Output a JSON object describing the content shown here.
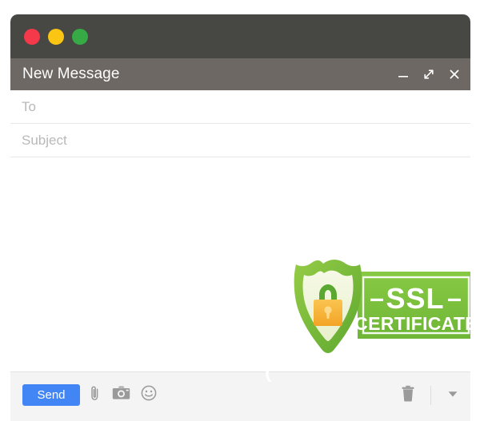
{
  "window": {
    "title": "New Message",
    "traffic_lights": [
      {
        "name": "close-traffic-light",
        "color": "#f5394a"
      },
      {
        "name": "minimize-traffic-light",
        "color": "#fbc513"
      },
      {
        "name": "maximize-traffic-light",
        "color": "#36ab45"
      }
    ],
    "controls": [
      {
        "name": "minimize-window-button",
        "icon": "minimize-icon"
      },
      {
        "name": "expand-window-button",
        "icon": "expand-diagonal-icon"
      },
      {
        "name": "close-window-button",
        "icon": "close-icon"
      }
    ],
    "chrome_bar_color": "#474744",
    "title_bar_color": "#6d6863"
  },
  "fields": [
    {
      "name": "to-field",
      "placeholder": "To",
      "value": ""
    },
    {
      "name": "subject-field",
      "placeholder": "Subject",
      "value": ""
    }
  ],
  "body": {
    "placeholder": "",
    "value": ""
  },
  "badge": {
    "line1": "SSL",
    "dash_left": "–",
    "dash_right": "–",
    "line2": "CERTIFICATE",
    "icon": "shield-lock-icon",
    "colors": {
      "shield_outer": "#6cb33f",
      "shield_mid": "#8cc63e",
      "shield_inner": "#f0f5d8",
      "box_green": "#79c143",
      "lock_body": "#f7b731",
      "lock_shackle": "#5aa832",
      "text": "#ffffff"
    }
  },
  "toolbar": {
    "send_label": "Send",
    "icons": [
      {
        "name": "attach-paperclip-icon",
        "label": "attach"
      },
      {
        "name": "camera-icon",
        "label": "insert photo"
      },
      {
        "name": "emoji-smiley-icon",
        "label": "insert emoji"
      }
    ],
    "right_icons": [
      {
        "name": "trash-icon",
        "label": "discard draft"
      },
      {
        "name": "chevron-down-icon",
        "label": "more options"
      }
    ],
    "accent_color": "#4285f4",
    "background_color": "#f4f4f4"
  }
}
